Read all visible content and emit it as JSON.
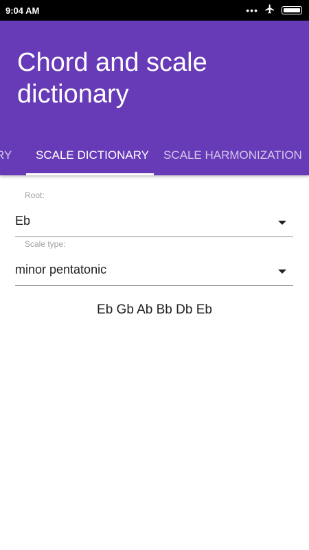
{
  "status_bar": {
    "time": "9:04 AM",
    "icons": [
      "more-dots-icon",
      "airplane-icon",
      "battery-icon"
    ]
  },
  "app_bar": {
    "title": "Chord and scale dictionary",
    "color": "#673ab7"
  },
  "tabs": [
    {
      "label": "RY",
      "active": false
    },
    {
      "label": "SCALE DICTIONARY",
      "active": true
    },
    {
      "label": "SCALE HARMONIZATION",
      "active": false
    }
  ],
  "form": {
    "root": {
      "label": "Root:",
      "value": "Eb"
    },
    "scale_type": {
      "label": "Scale type:",
      "value": "minor pentatonic"
    }
  },
  "result": "Eb Gb Ab Bb Db Eb"
}
